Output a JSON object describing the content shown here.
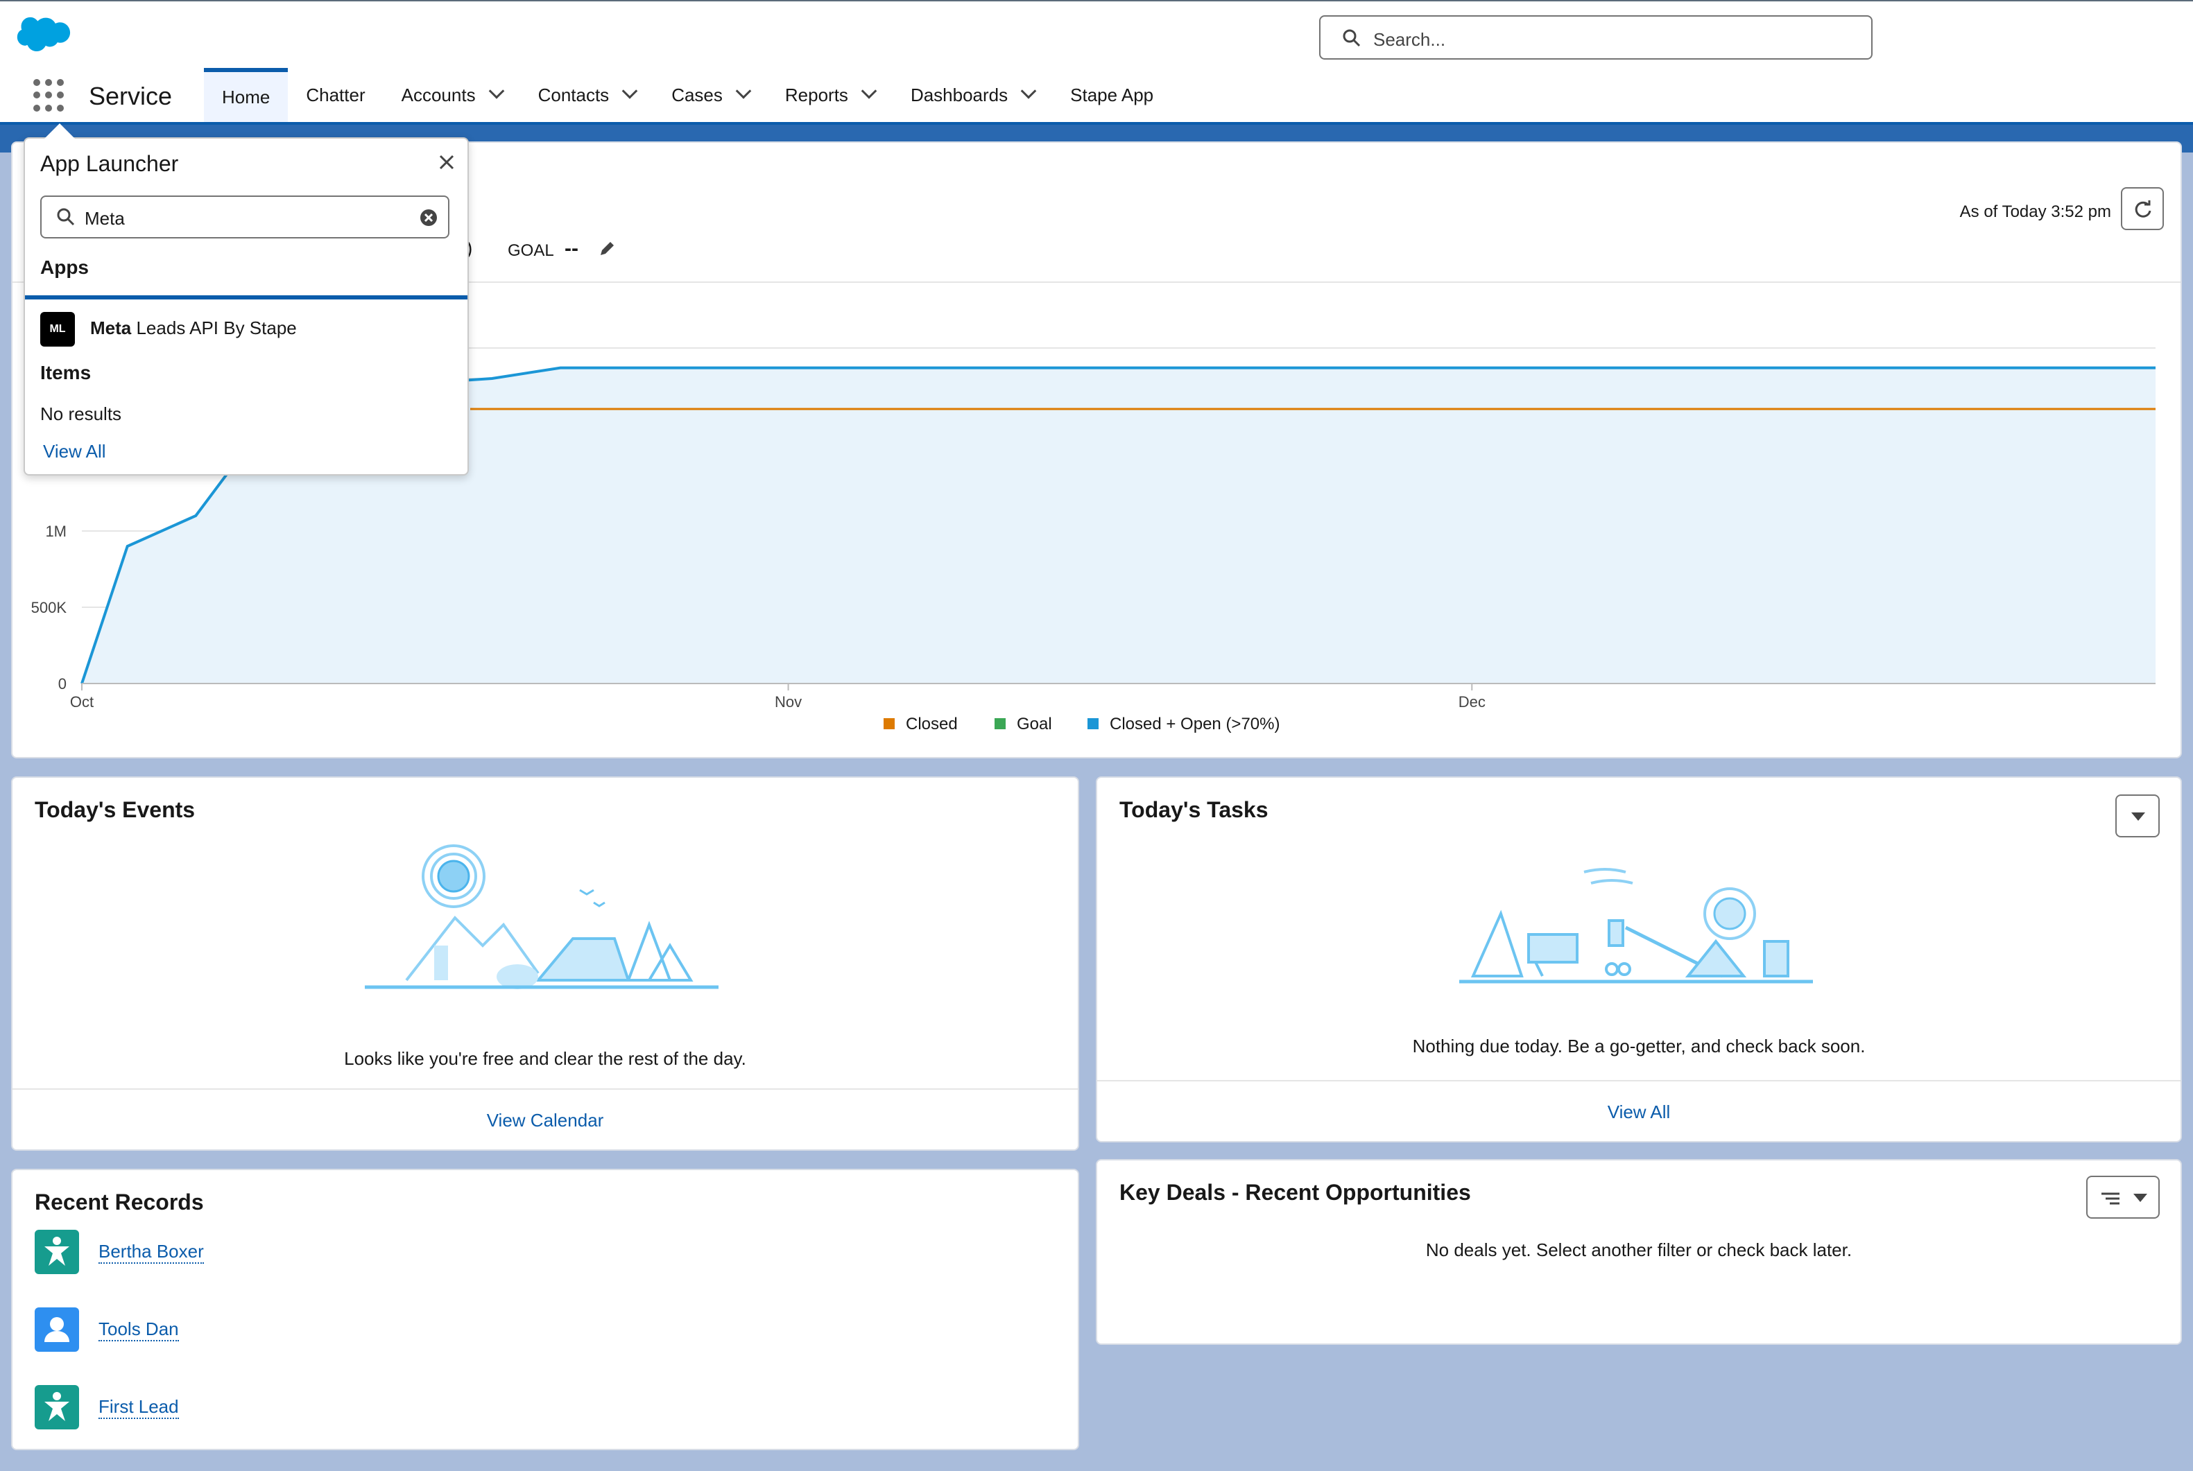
{
  "header": {
    "search_placeholder": "Search...",
    "app_name": "Service",
    "brand_color": "#00a1e0"
  },
  "nav": {
    "tabs": [
      {
        "label": "Home",
        "active": true,
        "has_menu": false
      },
      {
        "label": "Chatter",
        "active": false,
        "has_menu": false
      },
      {
        "label": "Accounts",
        "active": false,
        "has_menu": true
      },
      {
        "label": "Contacts",
        "active": false,
        "has_menu": true
      },
      {
        "label": "Cases",
        "active": false,
        "has_menu": true
      },
      {
        "label": "Reports",
        "active": false,
        "has_menu": true
      },
      {
        "label": "Dashboards",
        "active": false,
        "has_menu": true
      },
      {
        "label": "Stape App",
        "active": false,
        "has_menu": false
      }
    ]
  },
  "launcher": {
    "title": "App Launcher",
    "search_value": "Meta",
    "apps_heading": "Apps",
    "app_badge": "ML",
    "app_match": "Meta",
    "app_rest": " Leads API By Stape",
    "items_heading": "Items",
    "no_results": "No results",
    "view_all": "View All"
  },
  "performance": {
    "as_of": "As of Today 3:52 pm",
    "stray": ")",
    "goal_label": "GOAL",
    "goal_value": "--"
  },
  "chart_data": {
    "type": "area",
    "x_tick_labels": [
      "Oct",
      "Nov",
      "Dec"
    ],
    "y_tick_labels": [
      "0",
      "500K",
      "1M"
    ],
    "y_ticks": [
      0,
      500000,
      1000000
    ],
    "xlim": [
      0,
      91
    ],
    "ylim": [
      0,
      2500000
    ],
    "series": [
      {
        "name": "Closed",
        "color": "#dd7a01",
        "x": [
          0,
          91
        ],
        "y": [
          1800000,
          1800000
        ]
      },
      {
        "name": "Goal",
        "color": "#3ba755",
        "x": [],
        "y": []
      },
      {
        "name": "Closed + Open (>70%)",
        "color": "#1b96d6",
        "x": [
          0,
          2,
          5,
          7,
          11,
          15,
          18,
          21,
          91
        ],
        "y": [
          0,
          900000,
          1100000,
          1500000,
          1950000,
          1970000,
          2000000,
          2070000,
          2070000
        ]
      }
    ],
    "legend": "bottom",
    "grid": true
  },
  "events": {
    "title": "Today's Events",
    "message": "Looks like you're free and clear the rest of the day.",
    "link": "View Calendar"
  },
  "tasks": {
    "title": "Today's Tasks",
    "message": "Nothing due today. Be a go-getter, and check back soon.",
    "link": "View All"
  },
  "recent": {
    "title": "Recent Records",
    "items": [
      {
        "label": "Bertha Boxer",
        "icon": "lead-icon",
        "color": "#169c8e"
      },
      {
        "label": "Tools Dan",
        "icon": "contact-icon",
        "color": "#2e8ff0"
      },
      {
        "label": "First Lead",
        "icon": "lead-icon",
        "color": "#169c8e"
      }
    ]
  },
  "deals": {
    "title": "Key Deals - Recent Opportunities",
    "message": "No deals yet. Select another filter or check back later."
  }
}
